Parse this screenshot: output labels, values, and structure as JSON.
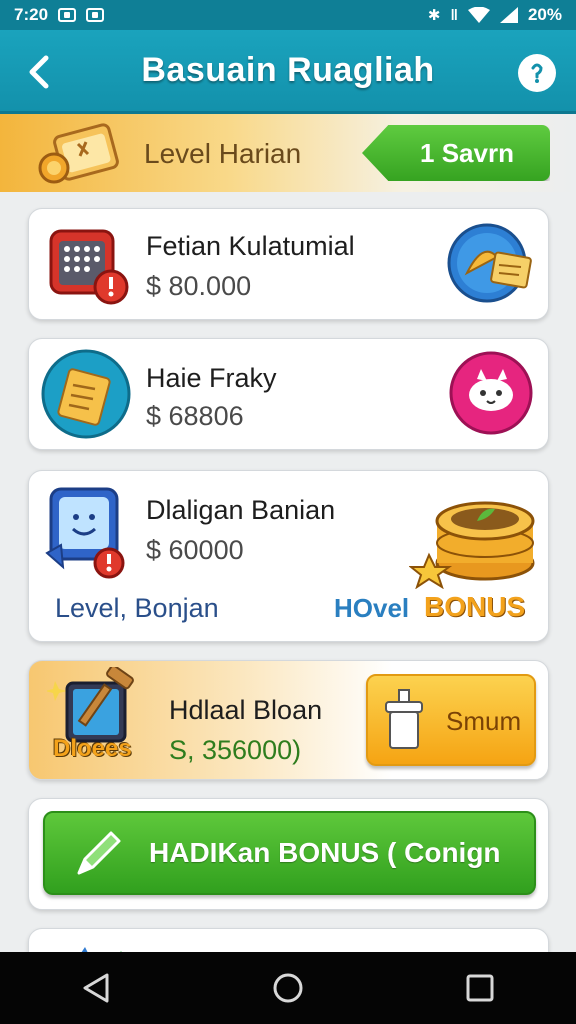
{
  "status_bar": {
    "time": "7:20",
    "battery": "20%"
  },
  "header": {
    "title": "Basuain Ruagliah"
  },
  "level_banner": {
    "label": "Level Harian",
    "save_label": "1 Savrn"
  },
  "rewards": [
    {
      "title": "Fetian Kulatumial",
      "amount": "$ 80.000"
    },
    {
      "title": "Haie Fraky",
      "amount": "$ 68806"
    },
    {
      "title": "Dlaligan Banian",
      "amount": "$ 60000",
      "footer_left": "Level, Bonjan",
      "footer_hovel": "HOvel",
      "footer_bonus": "BONUS"
    },
    {
      "title": "Hdlaal Bloan",
      "amount": "S, 356000)",
      "badge": "Dloees",
      "button_label": "Smum"
    }
  ],
  "bonus_button": {
    "label": "HADIKan BONUS ( Conign"
  },
  "colors": {
    "header": "#1391ab",
    "accent_green": "#36a321",
    "accent_orange": "#f5a413"
  }
}
